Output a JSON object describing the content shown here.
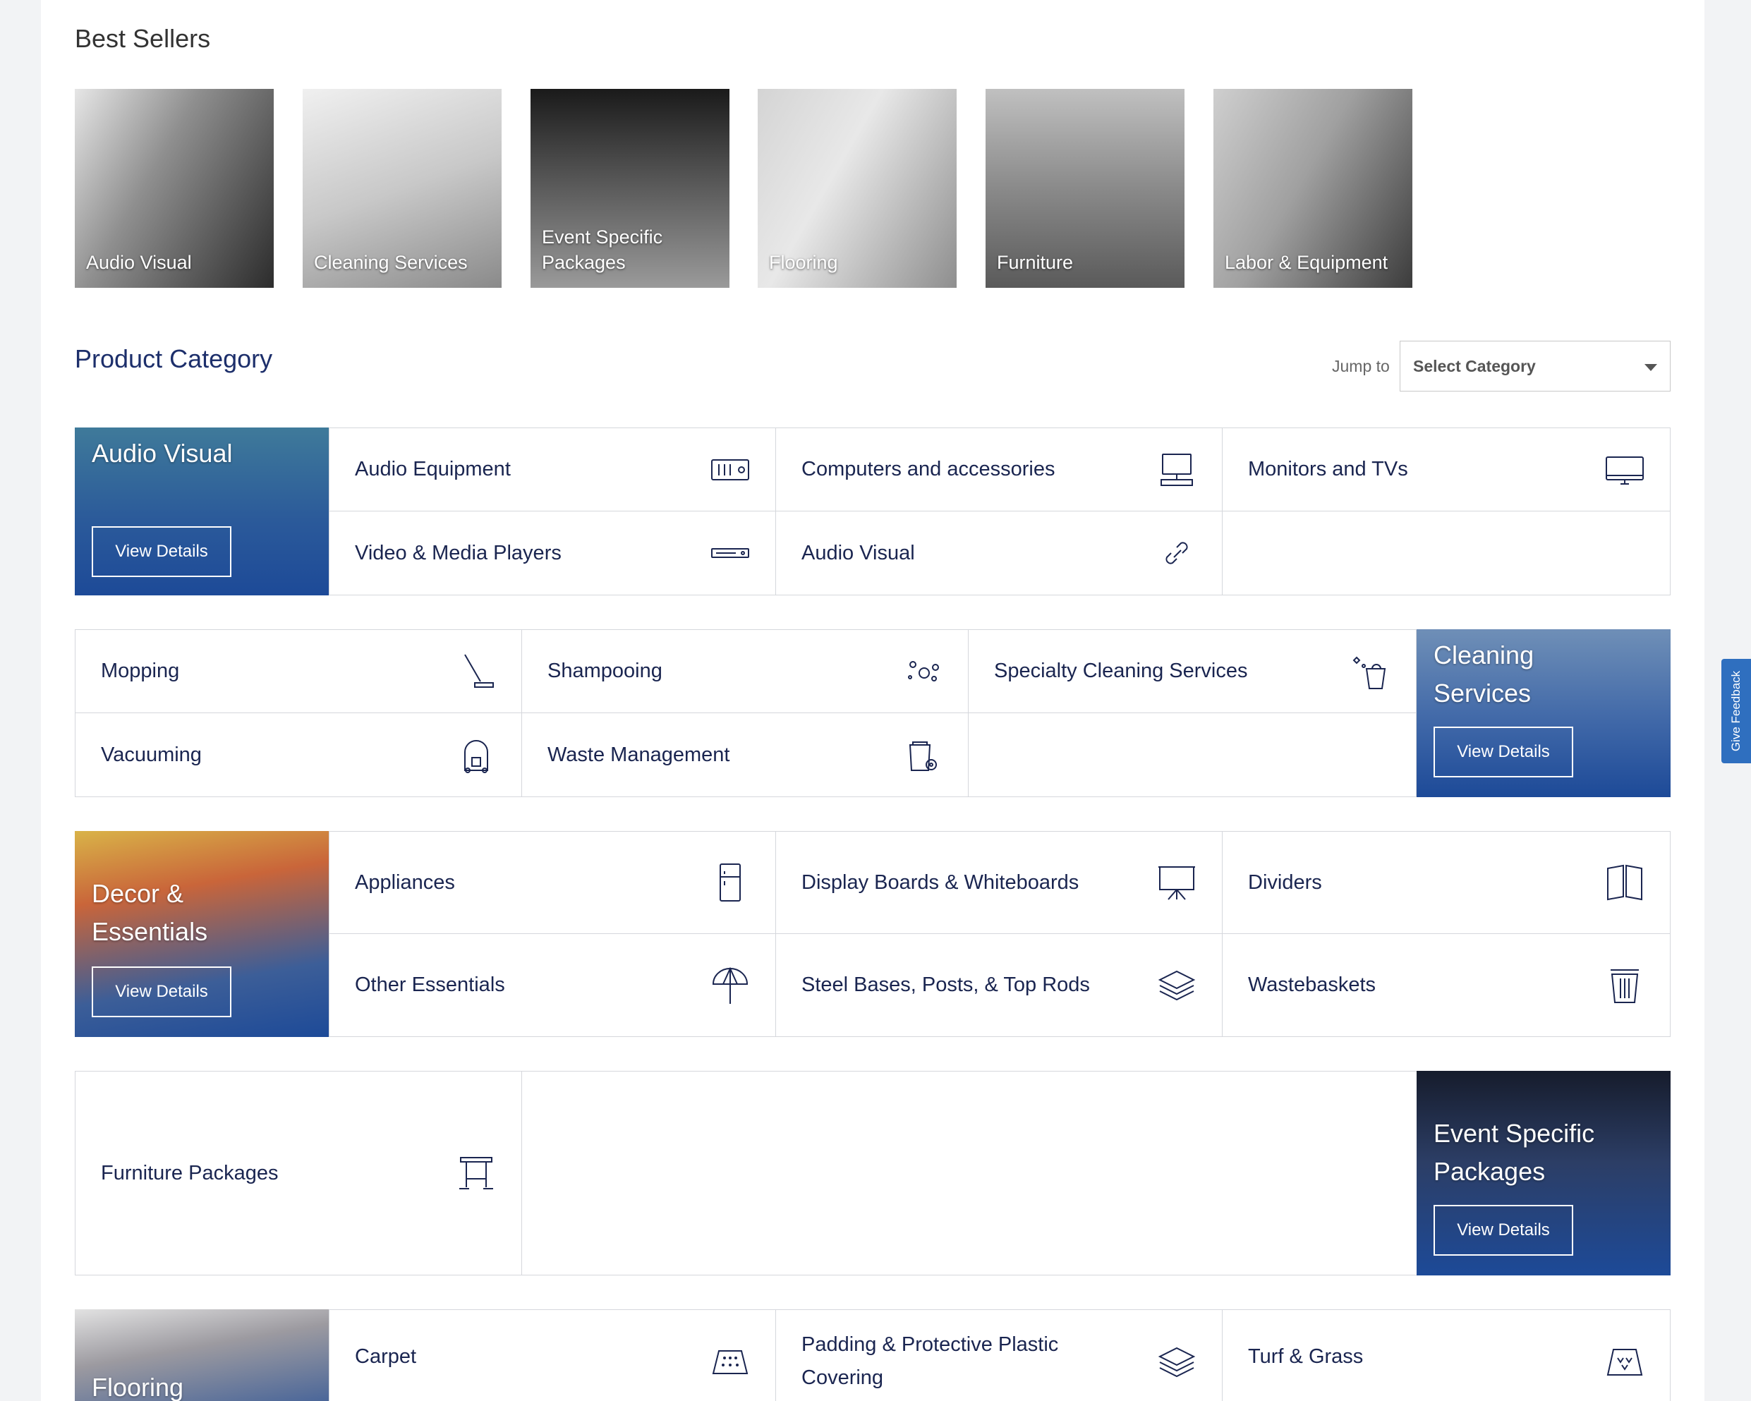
{
  "best_sellers": {
    "title": "Best Sellers",
    "tiles": [
      {
        "label": "Audio Visual"
      },
      {
        "label": "Cleaning Services"
      },
      {
        "label": "Event Specific Packages"
      },
      {
        "label": "Flooring"
      },
      {
        "label": "Furniture"
      },
      {
        "label": "Labor & Equipment"
      }
    ]
  },
  "product_category": {
    "title": "Product Category",
    "jump_label": "Jump to",
    "select_value": "Select Category"
  },
  "view_details_label": "View Details",
  "blocks": {
    "audio_visual": {
      "promo_title": "Audio Visual",
      "items": [
        "Audio Equipment",
        "Computers and accessories",
        "Monitors and TVs",
        "Video & Media Players",
        "Audio Visual"
      ]
    },
    "cleaning": {
      "promo_title": "Cleaning Services",
      "items": [
        "Mopping",
        "Shampooing",
        "Specialty Cleaning Services",
        "Vacuuming",
        "Waste Management"
      ]
    },
    "decor": {
      "promo_title": "Decor & Essentials",
      "items": [
        "Appliances",
        "Display Boards & Whiteboards",
        "Dividers",
        "Other Essentials",
        "Steel Bases, Posts, & Top Rods",
        "Wastebaskets"
      ]
    },
    "event": {
      "promo_title": "Event Specific Packages",
      "items": [
        "Furniture Packages"
      ]
    },
    "flooring": {
      "promo_title": "Flooring",
      "items": [
        "Carpet",
        "Padding & Protective Plastic Covering",
        "Turf & Grass"
      ]
    }
  },
  "feedback_label": "Give Feedback"
}
